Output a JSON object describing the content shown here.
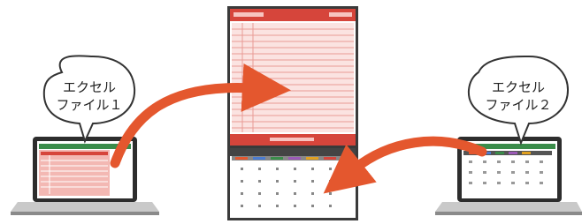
{
  "bubbles": {
    "left": {
      "line1": "エクセル",
      "line2": "ファイル１"
    },
    "right": {
      "line1": "エクセル",
      "line2": "ファイル２"
    }
  },
  "colors": {
    "accent": "#e4572e",
    "sheet_red": "#d6453b",
    "sheet_pink": "#f8d3d0",
    "laptop": "#2d2d2d"
  },
  "icons": [
    "laptop-left",
    "laptop-right",
    "printed-sheet",
    "arrow-icon"
  ]
}
